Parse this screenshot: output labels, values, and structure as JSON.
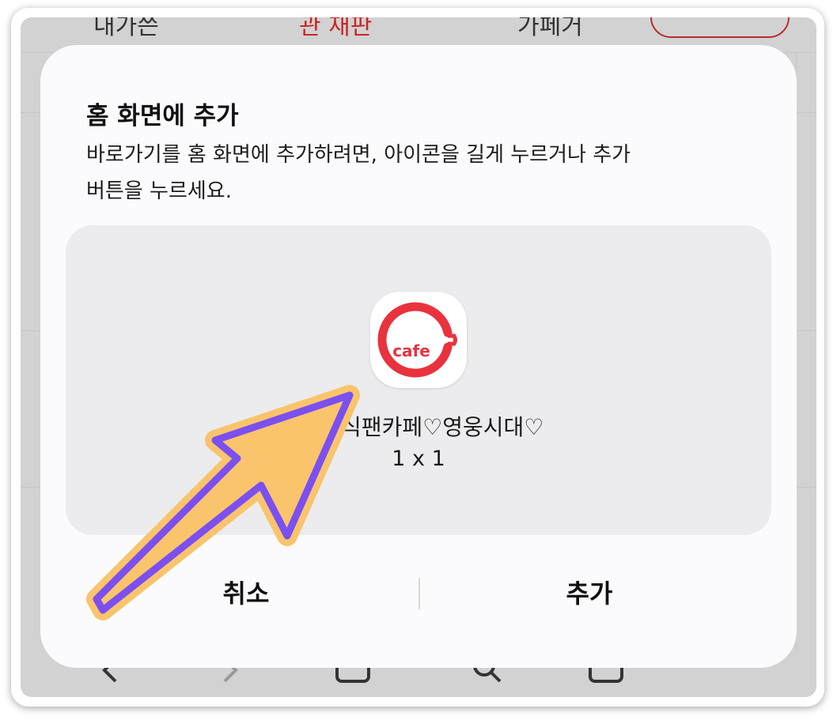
{
  "background": {
    "tab_left": "내가쓴",
    "tab_active": "관 재판",
    "tab_right": "가페거",
    "active_color": "#c62828"
  },
  "dialog": {
    "title": "홈 화면에 추가",
    "description_line1": "바로가기를 홈 화면에 추가하려면, 아이콘을 길게 누르거나 추가",
    "description_line2": "버튼을 누르세요.",
    "app_icon": {
      "name": "daum-cafe-icon",
      "label": "cafe",
      "ring_color": "#e8333e"
    },
    "shortcut_name": "임           공식팬카페♡영웅시대♡",
    "shortcut_size": "1 x 1",
    "cancel_label": "취소",
    "add_label": "추가"
  },
  "annotation": {
    "arrow_fill": "#f9c46b",
    "arrow_outline": "#7b4ff0"
  }
}
